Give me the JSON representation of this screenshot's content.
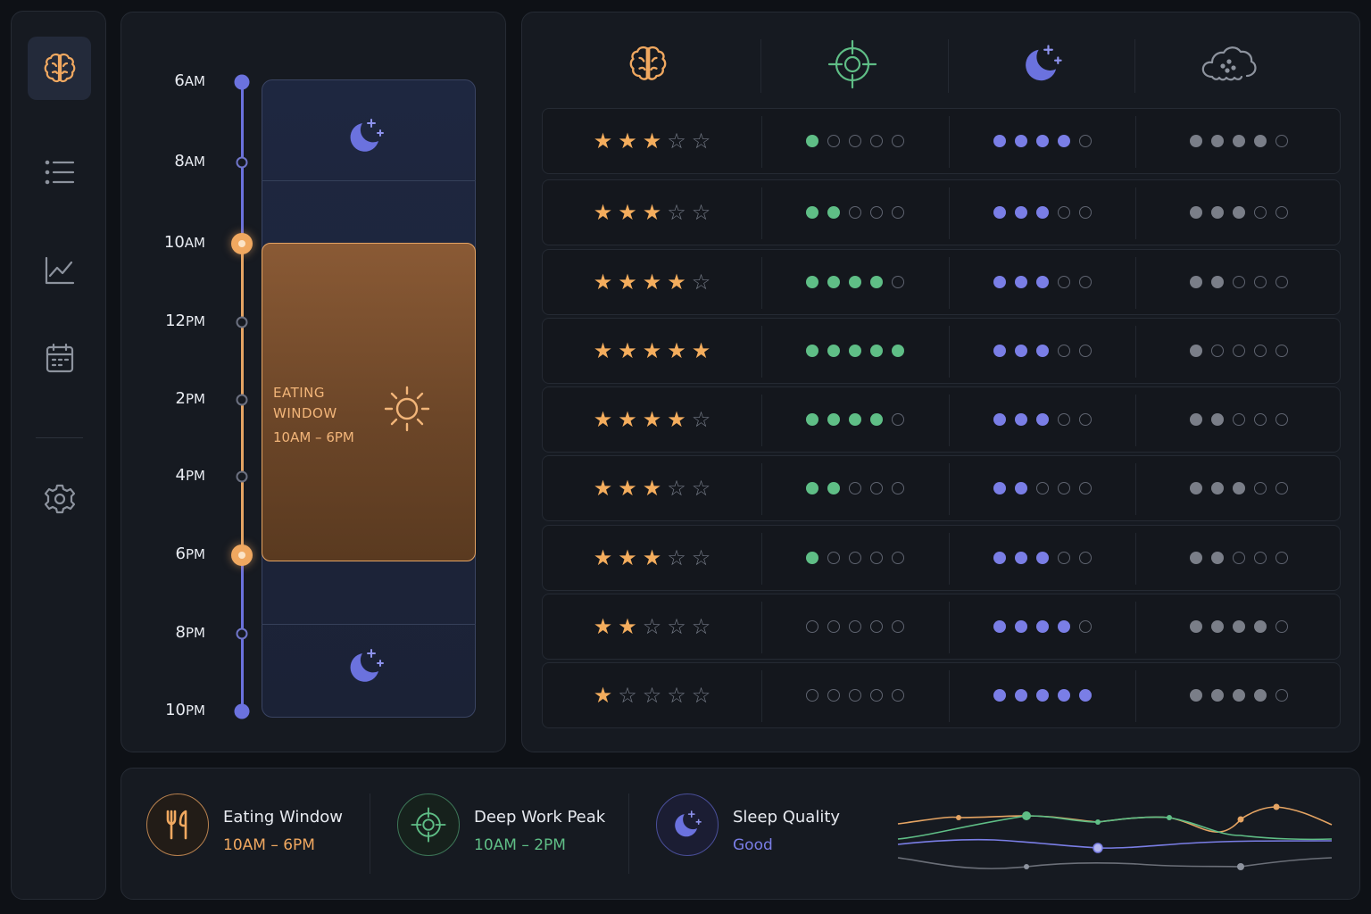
{
  "timeline": {
    "hours": [
      {
        "num": "6",
        "suffix": "AM"
      },
      {
        "num": "8",
        "suffix": "AM"
      },
      {
        "num": "10",
        "suffix": "AM"
      },
      {
        "num": "12",
        "suffix": "PM"
      },
      {
        "num": "2",
        "suffix": "PM"
      },
      {
        "num": "4",
        "suffix": "PM"
      },
      {
        "num": "6",
        "suffix": "PM"
      },
      {
        "num": "8",
        "suffix": "PM"
      },
      {
        "num": "10",
        "suffix": "PM"
      }
    ],
    "eating_window": {
      "title": "EATING WINDOW",
      "range": "10AM – 6PM"
    }
  },
  "table": {
    "columns": [
      "brain-icon",
      "target-icon",
      "moon-icon",
      "cloud-icon"
    ],
    "rows": [
      {
        "stars": 3,
        "focus": 1,
        "sleep": 4,
        "mood": 4
      },
      {
        "stars": 3,
        "focus": 2,
        "sleep": 3,
        "mood": 3
      },
      {
        "stars": 4,
        "focus": 4,
        "sleep": 3,
        "mood": 2
      },
      {
        "stars": 5,
        "focus": 5,
        "sleep": 3,
        "mood": 1
      },
      {
        "stars": 4,
        "focus": 4,
        "sleep": 3,
        "mood": 2
      },
      {
        "stars": 3,
        "focus": 2,
        "sleep": 2,
        "mood": 3
      },
      {
        "stars": 3,
        "focus": 1,
        "sleep": 3,
        "mood": 2
      },
      {
        "stars": 2,
        "focus": 0,
        "sleep": 4,
        "mood": 4
      },
      {
        "stars": 1,
        "focus": 0,
        "sleep": 5,
        "mood": 4
      }
    ]
  },
  "summary": {
    "eating": {
      "title": "Eating Window",
      "value": "10AM – 6PM",
      "color": "#f0a860"
    },
    "deepwork": {
      "title": "Deep Work Peak",
      "value": "10AM – 2PM",
      "color": "#5fbe86"
    },
    "sleep": {
      "title": "Sleep Quality",
      "value": "Good",
      "color": "#7a7ee6"
    }
  },
  "colors": {
    "accent_orange": "#f0a860",
    "accent_green": "#5fbe86",
    "accent_blue": "#7a7ee6",
    "muted": "#7a7e88"
  },
  "sidebar": {
    "items": [
      "brain-icon",
      "list-icon",
      "chart-icon",
      "calendar-icon",
      "gear-icon"
    ]
  }
}
